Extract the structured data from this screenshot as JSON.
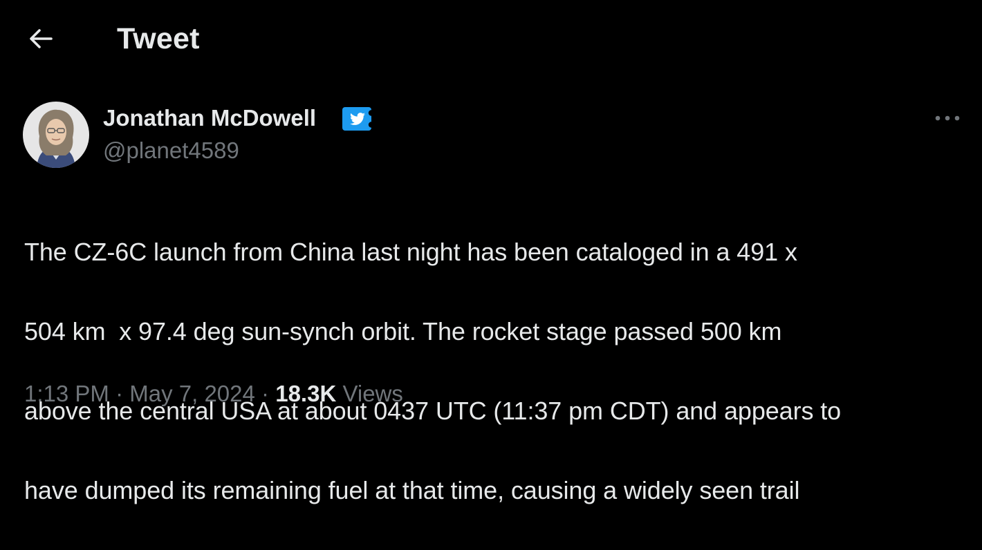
{
  "header": {
    "back_icon": "arrow-left-icon",
    "title": "Tweet"
  },
  "tweet": {
    "author": {
      "display_name": "Jonathan McDowell",
      "handle": "@planet4589",
      "verified_icon": "twitter-verified-icon",
      "avatar_icon": "avatar-photo"
    },
    "more_icon": "more-horizontal-icon",
    "text_lines": [
      "The CZ-6C launch from China last night has been cataloged in a 491 x",
      "504 km  x 97.4 deg sun-synch orbit. The rocket stage passed 500 km",
      "above the central USA at about 0437 UTC (11:37 pm CDT) and appears to",
      "have dumped its remaining fuel at that time, causing a widely seen trail"
    ],
    "time": "1:13 PM",
    "date": "May 7, 2024",
    "separator": "·",
    "views_count": "18.3K",
    "views_label": "Views"
  },
  "colors": {
    "background": "#000000",
    "primary_text": "#e7e9ea",
    "secondary_text": "#71767b",
    "verified_blue": "#1d9bf0"
  }
}
